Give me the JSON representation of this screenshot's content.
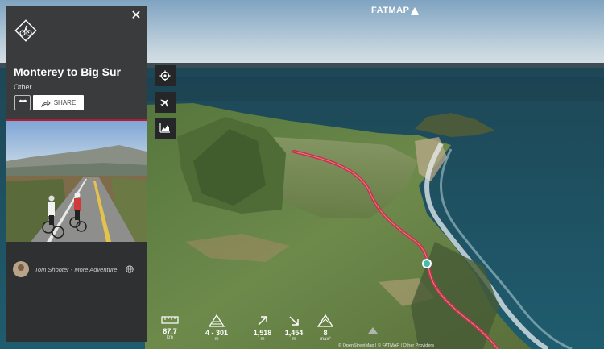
{
  "app": {
    "logo_text": "FATMAP"
  },
  "route": {
    "title": "Monterey to Big Sur",
    "activity": "Other",
    "activity_icon": "road-cycling-icon",
    "more_label": "•••",
    "share_label": "SHARE",
    "close_label": "✕"
  },
  "gallery": {
    "count": 6,
    "active": 0
  },
  "author": {
    "name": "Tom Shooter - More Adventure",
    "visibility_icon": "globe-icon"
  },
  "tools": [
    {
      "name": "locate-icon"
    },
    {
      "name": "flyover-icon"
    },
    {
      "name": "elevation-profile-icon"
    }
  ],
  "stats": [
    {
      "icon": "ruler-icon",
      "value": "87.7",
      "unit": "km"
    },
    {
      "icon": "elevation-range-icon",
      "value": "4 - 301",
      "unit": "m"
    },
    {
      "icon": "ascent-icon",
      "value": "1,518",
      "unit": "m"
    },
    {
      "icon": "descent-icon",
      "value": "1,454",
      "unit": "m"
    },
    {
      "icon": "max-slope-icon",
      "value": "8",
      "unit": "max°"
    }
  ],
  "attribution": "© OpenStreetMap | © FATMAP | Other Providers",
  "colors": {
    "route": "#c8324a",
    "panel": "#2f3032",
    "accent": "#b31c35",
    "marker": "#3fc1a8"
  }
}
